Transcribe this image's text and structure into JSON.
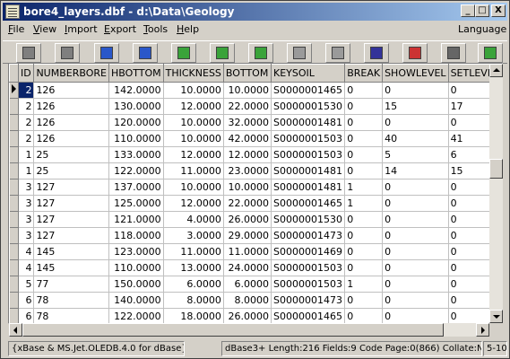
{
  "window": {
    "title": "bore4_layers.dbf - d:\\Data\\Geology",
    "min_label": "_",
    "max_label": "□",
    "close_label": "X"
  },
  "menu": {
    "items": [
      {
        "pre": "",
        "key": "F",
        "post": "ile"
      },
      {
        "pre": "",
        "key": "V",
        "post": "iew"
      },
      {
        "pre": "",
        "key": "I",
        "post": "mport"
      },
      {
        "pre": "",
        "key": "E",
        "post": "xport"
      },
      {
        "pre": "",
        "key": "T",
        "post": "ools"
      },
      {
        "pre": "",
        "key": "H",
        "post": "elp"
      }
    ],
    "language_label": "Language"
  },
  "toolbar": {
    "tools": [
      {
        "name": "first-record-icon",
        "color": "#7f7f7f"
      },
      {
        "name": "prior-record-icon",
        "color": "#7f7f7f"
      },
      {
        "name": "next-record-icon",
        "color": "#2a57c9"
      },
      {
        "name": "last-record-icon",
        "color": "#2a57c9"
      },
      {
        "name": "insert-record-icon",
        "color": "#3aa33a"
      },
      {
        "name": "delete-record-icon",
        "color": "#3aa33a"
      },
      {
        "name": "edit-record-icon",
        "color": "#3aa33a"
      },
      {
        "name": "post-record-icon",
        "color": "#9a9a9a"
      },
      {
        "name": "cancel-edit-icon",
        "color": "#9a9a9a"
      },
      {
        "name": "find-icon",
        "color": "#333399"
      },
      {
        "name": "filter-icon",
        "color": "#cc3333"
      },
      {
        "name": "print-icon",
        "color": "#666666"
      },
      {
        "name": "refresh-icon",
        "color": "#3aa33a"
      }
    ]
  },
  "grid": {
    "columns": [
      "ID",
      "NUMBERBORE",
      "HBOTTOM",
      "THICKNESS",
      "BOTTOM",
      "KEYSOIL",
      "BREAK",
      "SHOWLEVEL",
      "SETLEVEL"
    ],
    "rows": [
      [
        "2",
        "126",
        "142.0000",
        "10.0000",
        "10.0000",
        "S0000001465",
        "0",
        "0",
        "0"
      ],
      [
        "2",
        "126",
        "130.0000",
        "12.0000",
        "22.0000",
        "S0000001530",
        "0",
        "15",
        "17"
      ],
      [
        "2",
        "126",
        "120.0000",
        "10.0000",
        "32.0000",
        "S0000001481",
        "0",
        "0",
        "0"
      ],
      [
        "2",
        "126",
        "110.0000",
        "10.0000",
        "42.0000",
        "S0000001503",
        "0",
        "40",
        "41"
      ],
      [
        "1",
        "25",
        "133.0000",
        "12.0000",
        "12.0000",
        "S0000001503",
        "0",
        "5",
        "6"
      ],
      [
        "1",
        "25",
        "122.0000",
        "11.0000",
        "23.0000",
        "S0000001481",
        "0",
        "14",
        "15"
      ],
      [
        "3",
        "127",
        "137.0000",
        "10.0000",
        "10.0000",
        "S0000001481",
        "1",
        "0",
        "0"
      ],
      [
        "3",
        "127",
        "125.0000",
        "12.0000",
        "22.0000",
        "S0000001465",
        "1",
        "0",
        "0"
      ],
      [
        "3",
        "127",
        "121.0000",
        "4.0000",
        "26.0000",
        "S0000001530",
        "0",
        "0",
        "0"
      ],
      [
        "3",
        "127",
        "118.0000",
        "3.0000",
        "29.0000",
        "S0000001473",
        "0",
        "0",
        "0"
      ],
      [
        "4",
        "145",
        "123.0000",
        "11.0000",
        "11.0000",
        "S0000001469",
        "0",
        "0",
        "0"
      ],
      [
        "4",
        "145",
        "110.0000",
        "13.0000",
        "24.0000",
        "S0000001503",
        "0",
        "0",
        "0"
      ],
      [
        "5",
        "77",
        "150.0000",
        "6.0000",
        "6.0000",
        "S0000001503",
        "1",
        "0",
        "0"
      ],
      [
        "6",
        "78",
        "140.0000",
        "8.0000",
        "8.0000",
        "S0000001473",
        "0",
        "0",
        "0"
      ],
      [
        "6",
        "78",
        "122.0000",
        "18.0000",
        "26.0000",
        "S0000001465",
        "0",
        "0",
        "0"
      ]
    ],
    "current_row": 0
  },
  "status": {
    "driver": "{xBase & MS.Jet.OLEDB.4.0 for dBase}",
    "info": "dBase3+  Length:216  Fields:9  Code Page:0(866)  Collate:None",
    "extra": "5-10"
  }
}
